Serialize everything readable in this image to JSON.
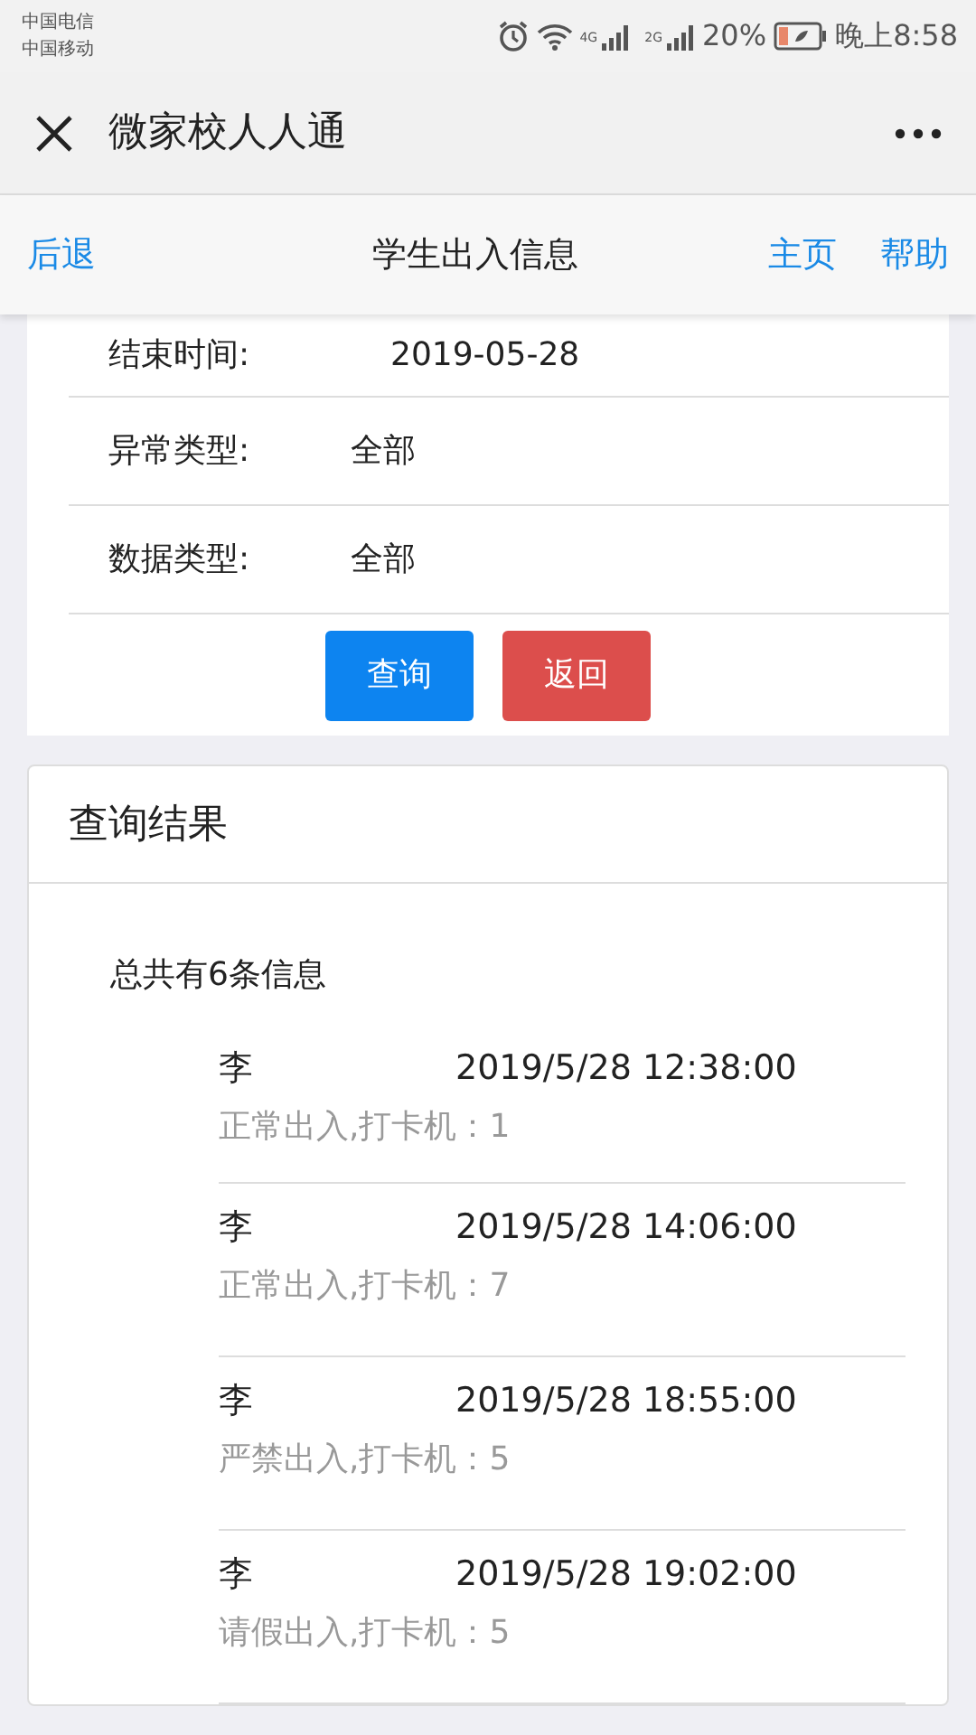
{
  "status_bar": {
    "carriers": [
      "中国电信",
      "中国移动"
    ],
    "network_1": "4G",
    "network_2": "2G",
    "battery": "20%",
    "time": "晚上8:58"
  },
  "app_bar": {
    "title": "微家校人人通"
  },
  "nav_bar": {
    "back": "后退",
    "title": "学生出入信息",
    "links": [
      "主页",
      "帮助"
    ]
  },
  "filter": {
    "fields": [
      {
        "label": "结束时间:",
        "value": "2019-05-28"
      },
      {
        "label": "异常类型:",
        "value": "全部"
      },
      {
        "label": "数据类型:",
        "value": "全部"
      }
    ],
    "buttons": [
      {
        "label": "查询",
        "kind": "primary"
      },
      {
        "label": "返回",
        "kind": "danger"
      }
    ]
  },
  "results": {
    "title": "查询结果",
    "summary": "总共有6条信息",
    "records": [
      {
        "name": "李",
        "time": "2019/5/28 12:38:00",
        "detail": "正常出入,打卡机：1"
      },
      {
        "name": "李",
        "time": "2019/5/28 14:06:00",
        "detail": "正常出入,打卡机：7"
      },
      {
        "name": "李",
        "time": "2019/5/28 18:55:00",
        "detail": "严禁出入,打卡机：5"
      },
      {
        "name": "李",
        "time": "2019/5/28 19:02:00",
        "detail": "请假出入,打卡机：5"
      }
    ]
  }
}
